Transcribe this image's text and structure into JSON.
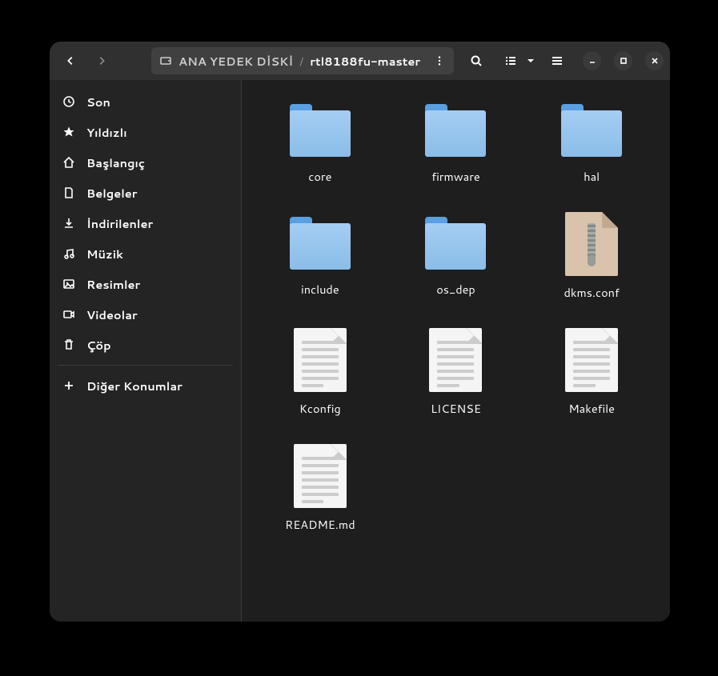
{
  "breadcrumb": {
    "root_label": "ANA YEDEK DİSKİ",
    "current_label": "rtl8188fu-master"
  },
  "sidebar": {
    "items": [
      {
        "icon": "clock",
        "label": "Son"
      },
      {
        "icon": "star",
        "label": "Yıldızlı"
      },
      {
        "icon": "home",
        "label": "Başlangıç"
      },
      {
        "icon": "document",
        "label": "Belgeler"
      },
      {
        "icon": "download",
        "label": "İndirilenler"
      },
      {
        "icon": "music",
        "label": "Müzik"
      },
      {
        "icon": "image",
        "label": "Resimler"
      },
      {
        "icon": "video",
        "label": "Videolar"
      },
      {
        "icon": "trash",
        "label": "Çöp"
      }
    ],
    "other_locations_label": "Diğer Konumlar"
  },
  "files": [
    {
      "name": "core",
      "type": "folder"
    },
    {
      "name": "firmware",
      "type": "folder"
    },
    {
      "name": "hal",
      "type": "folder"
    },
    {
      "name": "include",
      "type": "folder"
    },
    {
      "name": "os_dep",
      "type": "folder"
    },
    {
      "name": "dkms.conf",
      "type": "archive"
    },
    {
      "name": "Kconfig",
      "type": "text"
    },
    {
      "name": "LICENSE",
      "type": "text"
    },
    {
      "name": "Makefile",
      "type": "text"
    },
    {
      "name": "README.md",
      "type": "text"
    }
  ]
}
